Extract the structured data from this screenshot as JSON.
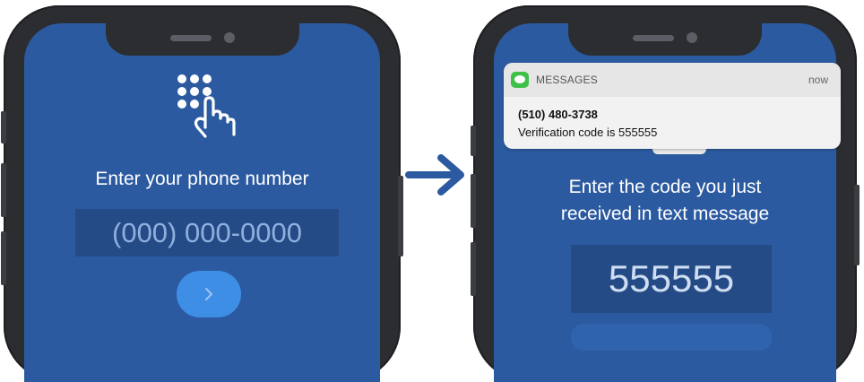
{
  "left_screen": {
    "prompt": "Enter your phone number",
    "phone_placeholder": "(000) 000-0000",
    "next_icon": "chevron-right-icon",
    "keypad_icon": "keypad-tap-icon"
  },
  "right_screen": {
    "prompt_line1": "Enter the code you just",
    "prompt_line2": "received in text message",
    "code": "555555"
  },
  "notification": {
    "app_name": "MESSAGES",
    "time": "now",
    "sender": "(510) 480-3738",
    "body": "Verification code is 555555",
    "app_icon": "messages-app-icon"
  },
  "arrow_icon": "arrow-right-icon",
  "colors": {
    "screen_bg": "#2c5aa0",
    "input_bg": "#244b86",
    "button": "#3f8ee6",
    "arrow": "#2c5aa0",
    "bezel": "#2b2d31",
    "messages_green": "#3fc148"
  }
}
